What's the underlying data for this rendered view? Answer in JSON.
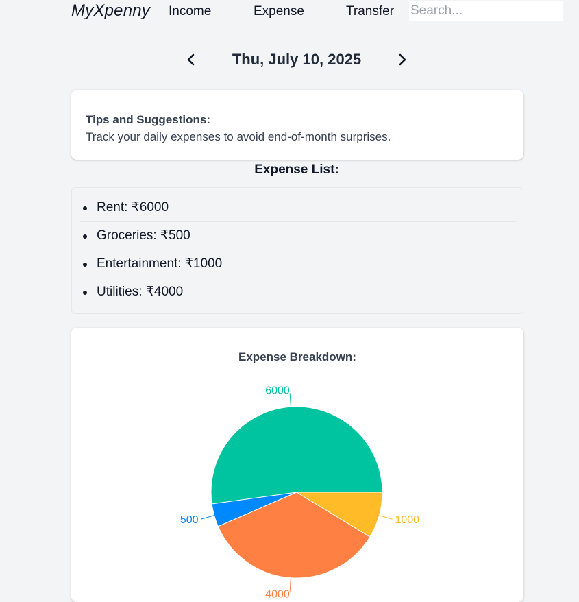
{
  "nav": {
    "brand": "MyXpenny",
    "income": "Income",
    "expense": "Expense",
    "transfer": "Transfer",
    "search_placeholder": "Search..."
  },
  "date": {
    "label": "Thu, July 10, 2025",
    "prev_icon": "chevron-left-icon",
    "next_icon": "chevron-right-icon"
  },
  "tips": {
    "title": "Tips and Suggestions:",
    "body": "Track your daily expenses to avoid end-of-month surprises."
  },
  "expense_list": {
    "heading": "Expense List:",
    "items": [
      {
        "label": "Rent: ₹6000"
      },
      {
        "label": "Groceries: ₹500"
      },
      {
        "label": "Entertainment: ₹1000"
      },
      {
        "label": "Utilities: ₹4000"
      }
    ]
  },
  "chart_data": {
    "type": "pie",
    "title": "Expense Breakdown:",
    "slices": [
      {
        "value": 6000,
        "label": "6000",
        "color": "#00c49f"
      },
      {
        "value": 500,
        "label": "500",
        "color": "#0088fe"
      },
      {
        "value": 4000,
        "label": "4000",
        "color": "#ff8042"
      },
      {
        "value": 1000,
        "label": "1000",
        "color": "#ffbb28"
      }
    ]
  }
}
